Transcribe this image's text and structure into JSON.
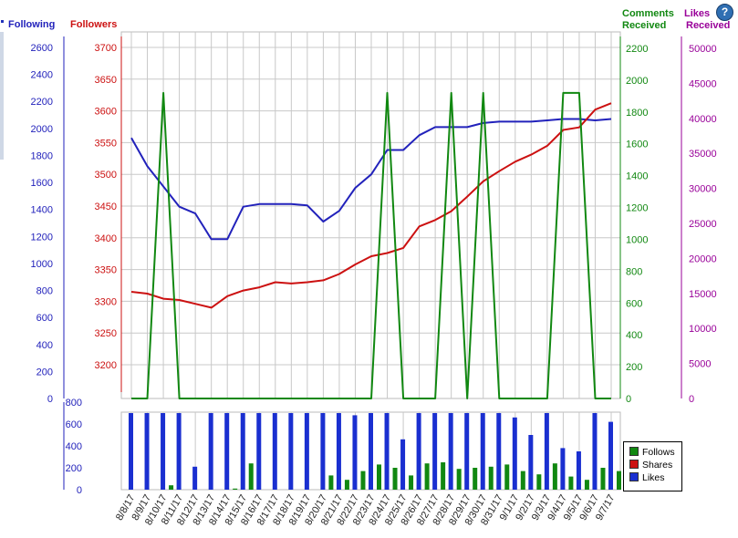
{
  "headers": {
    "following": "Following",
    "followers": "Followers",
    "comments": [
      "Comments",
      "Received"
    ],
    "likes": [
      "Likes",
      "Received"
    ]
  },
  "help_icon": "question-mark-icon",
  "colors": {
    "following": "#2222bb",
    "followers": "#cc1111",
    "comments": "#118811",
    "likes": "#990099",
    "grid": "#c8c8c8",
    "bar_follows": "#118811",
    "bar_shares": "#cc1111",
    "bar_likes": "#1a2fd0"
  },
  "legend": [
    {
      "label": "Follows",
      "color": "#118811"
    },
    {
      "label": "Shares",
      "color": "#cc1111"
    },
    {
      "label": "Likes",
      "color": "#1a2fd0"
    }
  ],
  "chart_data": [
    {
      "type": "line",
      "categories": [
        "8/8/17",
        "8/9/17",
        "8/10/17",
        "8/11/17",
        "8/12/17",
        "8/13/17",
        "8/14/17",
        "8/15/17",
        "8/16/17",
        "8/17/17",
        "8/18/17",
        "8/19/17",
        "8/20/17",
        "8/21/17",
        "8/22/17",
        "8/23/17",
        "8/24/17",
        "8/25/17",
        "8/26/17",
        "8/27/17",
        "8/28/17",
        "8/29/17",
        "8/30/17",
        "8/31/17",
        "9/1/17",
        "9/2/17",
        "9/3/17",
        "9/4/17",
        "9/5/17",
        "9/6/17",
        "9/7/17"
      ],
      "axes": {
        "following": {
          "ticks": [
            0,
            200,
            400,
            600,
            800,
            1000,
            1200,
            1400,
            1600,
            1800,
            2000,
            2200,
            2400,
            2600
          ]
        },
        "followers": {
          "ticks": [
            3200,
            3250,
            3300,
            3350,
            3400,
            3450,
            3500,
            3550,
            3600,
            3650,
            3700
          ]
        },
        "comments": {
          "ticks": [
            0,
            200,
            400,
            600,
            800,
            1000,
            1200,
            1400,
            1600,
            1800,
            2000,
            2200
          ]
        },
        "likes": {
          "ticks": [
            0,
            5000,
            10000,
            15000,
            20000,
            25000,
            30000,
            35000,
            40000,
            45000,
            50000
          ]
        }
      },
      "series": [
        {
          "name": "Following",
          "axis": "following",
          "values": [
            1930,
            1720,
            1570,
            1420,
            1370,
            1180,
            1180,
            1420,
            1440,
            1440,
            1440,
            1430,
            1310,
            1390,
            1560,
            1660,
            1840,
            1840,
            1950,
            2010,
            2010,
            2010,
            2040,
            2050,
            2050,
            2050,
            2060,
            2070,
            2070,
            2060,
            2070
          ]
        },
        {
          "name": "Followers",
          "axis": "followers",
          "values": [
            3315,
            3312,
            3304,
            3302,
            3296,
            3290,
            3308,
            3317,
            3322,
            3330,
            3328,
            3330,
            3333,
            3343,
            3358,
            3371,
            3376,
            3384,
            3418,
            3428,
            3442,
            3465,
            3489,
            3505,
            3520,
            3531,
            3545,
            3570,
            3574,
            3602,
            3612
          ]
        },
        {
          "name": "Comments Received",
          "axis": "comments",
          "values": [
            0,
            0,
            1920,
            0,
            0,
            0,
            0,
            0,
            0,
            0,
            0,
            0,
            0,
            0,
            0,
            0,
            1920,
            0,
            0,
            0,
            1920,
            0,
            1920,
            0,
            0,
            0,
            0,
            1920,
            1920,
            0,
            0
          ]
        }
      ]
    },
    {
      "type": "bar",
      "categories": [
        "8/8/17",
        "8/9/17",
        "8/10/17",
        "8/11/17",
        "8/12/17",
        "8/13/17",
        "8/14/17",
        "8/15/17",
        "8/16/17",
        "8/17/17",
        "8/18/17",
        "8/19/17",
        "8/20/17",
        "8/21/17",
        "8/22/17",
        "8/23/17",
        "8/24/17",
        "8/25/17",
        "8/26/17",
        "8/27/17",
        "8/28/17",
        "8/29/17",
        "8/30/17",
        "8/31/17",
        "9/1/17",
        "9/2/17",
        "9/3/17",
        "9/4/17",
        "9/5/17",
        "9/6/17",
        "9/7/17"
      ],
      "ylim": [
        0,
        800
      ],
      "yticks": [
        0,
        200,
        400,
        600,
        800
      ],
      "series": [
        {
          "name": "Likes",
          "values": [
            700,
            700,
            700,
            700,
            210,
            700,
            700,
            700,
            700,
            700,
            700,
            700,
            700,
            700,
            680,
            700,
            700,
            460,
            700,
            700,
            700,
            700,
            700,
            700,
            660,
            500,
            700,
            380,
            350,
            700,
            620
          ]
        },
        {
          "name": "Follows",
          "values": [
            0,
            0,
            40,
            0,
            0,
            0,
            10,
            240,
            0,
            0,
            0,
            0,
            130,
            90,
            170,
            230,
            200,
            130,
            240,
            250,
            190,
            200,
            210,
            230,
            170,
            140,
            240,
            120,
            90,
            200,
            170
          ]
        }
      ]
    }
  ]
}
